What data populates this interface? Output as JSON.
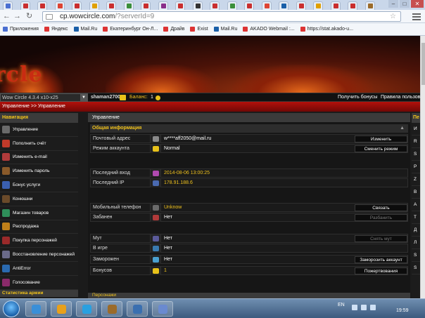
{
  "browser": {
    "url_host": "cp.wowcircle.com",
    "url_path": "/?serverId=9",
    "tab_colors": [
      "#4a6fd1",
      "#c92e2e",
      "#c92e2e",
      "#d43",
      "#c92e2e",
      "#e0a000",
      "#c92e2e",
      "#3a8f3a",
      "#c92e2e",
      "#8a2e8a",
      "#c92e2e",
      "#333",
      "#c92e2e",
      "#3a8f3a",
      "#c92e2e",
      "#d43",
      "#1a5fa8",
      "#c92e2e",
      "#e0a000",
      "#c92e2e",
      "#c92e2e",
      "#9b6b2a"
    ],
    "bookmarks": [
      {
        "label": "Приложения",
        "color": "#4a6fd1"
      },
      {
        "label": "Яндекс",
        "color": "#d33"
      },
      {
        "label": "Mail.Ru",
        "color": "#1a5fa8"
      },
      {
        "label": "Екатеринбург Он-Л...",
        "color": "#d33"
      },
      {
        "label": "Драйв",
        "color": "#d33"
      },
      {
        "label": "Exist",
        "color": "#d33"
      },
      {
        "label": "Mail.Ru",
        "color": "#1a5fa8"
      },
      {
        "label": "AKADO Webmail :...",
        "color": "#d33"
      },
      {
        "label": "https://stat.akado-u...",
        "color": "#d33"
      }
    ]
  },
  "site": {
    "logo_text": "rcle",
    "realm_select": "Wow Circle 4.3.4 x10-x25",
    "username": "shaman2700",
    "balance_label": "Баланс:",
    "balance_value": "1",
    "get_bonuses": "Получить бонусы",
    "rules": "Правила пользов",
    "breadcrumb": "Управление >> Управление"
  },
  "sidebar": {
    "header": "Навигация",
    "items": [
      {
        "label": "Управление",
        "color": "#6a6a6a"
      },
      {
        "label": "Пополнить счёт",
        "color": "#c03a2a"
      },
      {
        "label": "Изменить e-mail",
        "color": "#b23b3b"
      },
      {
        "label": "Изменить пароль",
        "color": "#8a5a2a"
      },
      {
        "label": "Бонус услуги",
        "color": "#3a5fb0"
      },
      {
        "label": "Конюшни",
        "color": "#6a4a2a"
      },
      {
        "label": "Магазин товаров",
        "color": "#2f8f5a"
      },
      {
        "label": "Распродажа",
        "color": "#c0801a"
      },
      {
        "label": "Покупка персонажей",
        "color": "#9b2a2a"
      },
      {
        "label": "Восстановление персонажей",
        "color": "#6a6a8a"
      },
      {
        "label": "AntiError",
        "color": "#2a6ab0"
      },
      {
        "label": "Голосование",
        "color": "#8a2a6a"
      }
    ],
    "footer": "Статистика армии"
  },
  "main": {
    "header": "Управление",
    "section": "Общая информация",
    "collapse": "▲",
    "rows": [
      {
        "label": "Почтовый адрес",
        "value": "w****aff2050@mail.ru",
        "accent": false,
        "icon": "#8a8a8a",
        "button": "Изменить",
        "disabled": false
      },
      {
        "label": "Режим аккаунта",
        "value": "Normal",
        "accent": false,
        "icon": "#e8c21a",
        "button": "Сменить режим",
        "disabled": false
      },
      {
        "label": "Последний вход",
        "value": "2014-08-06 13:00:25",
        "accent": true,
        "icon": "#b04ab0",
        "button": "",
        "disabled": false
      },
      {
        "label": "Последний IP",
        "value": "178.91.188.6",
        "accent": true,
        "icon": "#4a6ab0",
        "button": "",
        "disabled": false
      },
      {
        "label": "Мобильный телефон",
        "value": "Unknow",
        "accent": true,
        "icon": "#6a6a6a",
        "button": "Связать",
        "disabled": false
      },
      {
        "label": "Забанен",
        "value": "Нет",
        "accent": false,
        "icon": "#b03a3a",
        "button": "Разбанить",
        "disabled": true
      },
      {
        "label": "Мут",
        "value": "Нет",
        "accent": false,
        "icon": "#5a5a9a",
        "button": "Снять мут",
        "disabled": true
      },
      {
        "label": "В игре",
        "value": "Нет",
        "accent": false,
        "icon": "#3a7ab0",
        "button": "",
        "disabled": false
      },
      {
        "label": "Заморожен",
        "value": "Нет",
        "accent": false,
        "icon": "#4aa0d0",
        "button": "Заморозить аккаунт",
        "disabled": false
      },
      {
        "label": "Бонусов",
        "value": "1",
        "accent": true,
        "icon": "#e8c21a",
        "button": "Пожертвования",
        "disabled": false
      }
    ],
    "footer": "Персонажи"
  },
  "right_panel": {
    "header": "Пе",
    "items": [
      "И",
      "R",
      "S",
      "P",
      "Z",
      "B",
      "A",
      "T",
      "Д",
      "Л",
      "S",
      "S"
    ]
  },
  "taskbar": {
    "apps": [
      "#3a8fd8",
      "#e8a01a",
      "#2aa0e0",
      "#9b6b2a",
      "#3a6fb0",
      "#6a8ad0"
    ],
    "lang": "EN",
    "time": "19:59"
  }
}
